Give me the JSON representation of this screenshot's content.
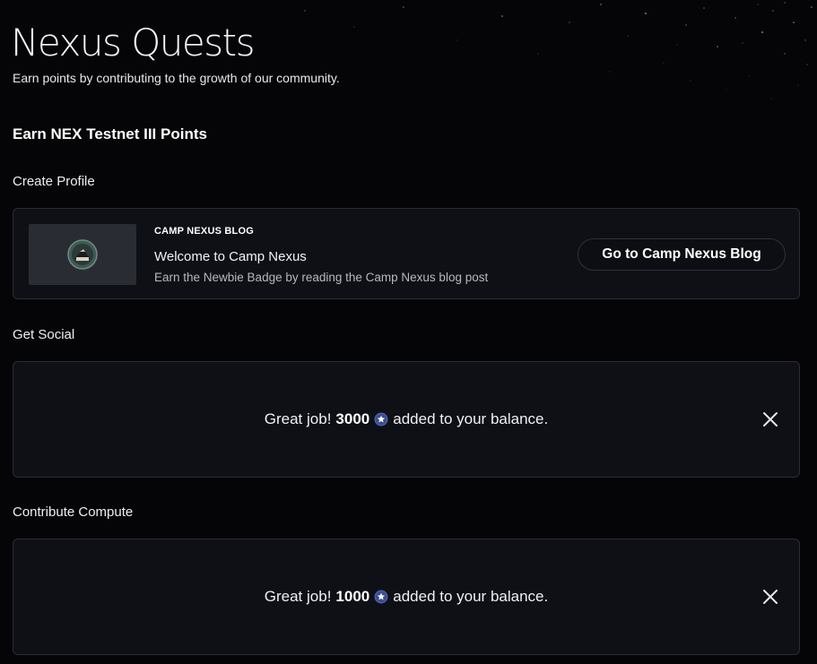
{
  "page": {
    "title": "Nexus Quests",
    "subtitle": "Earn points by contributing to the growth of our community."
  },
  "section": {
    "heading": "Earn NEX Testnet III Points"
  },
  "groups": {
    "create_profile": "Create Profile",
    "get_social": "Get Social",
    "contribute_compute": "Contribute Compute"
  },
  "blog_card": {
    "kicker": "CAMP NEXUS BLOG",
    "title": "Welcome to Camp Nexus",
    "description": "Earn the Newbie Badge by reading the Camp Nexus blog post",
    "button_label": "Go to Camp Nexus Blog",
    "thumbnail_icon": "camp-nexus-logo-icon"
  },
  "social_reward": {
    "prefix": "Great job!",
    "amount": "3000",
    "suffix": "added to your balance.",
    "badge_icon": "star-badge-icon"
  },
  "compute_reward": {
    "prefix": "Great job!",
    "amount": "1000",
    "suffix": "added to your balance.",
    "badge_icon": "star-badge-icon"
  },
  "colors": {
    "background": "#050507",
    "card_background": "#0e1016",
    "card_border": "#2a2d36",
    "badge": "#4a5fa8"
  }
}
